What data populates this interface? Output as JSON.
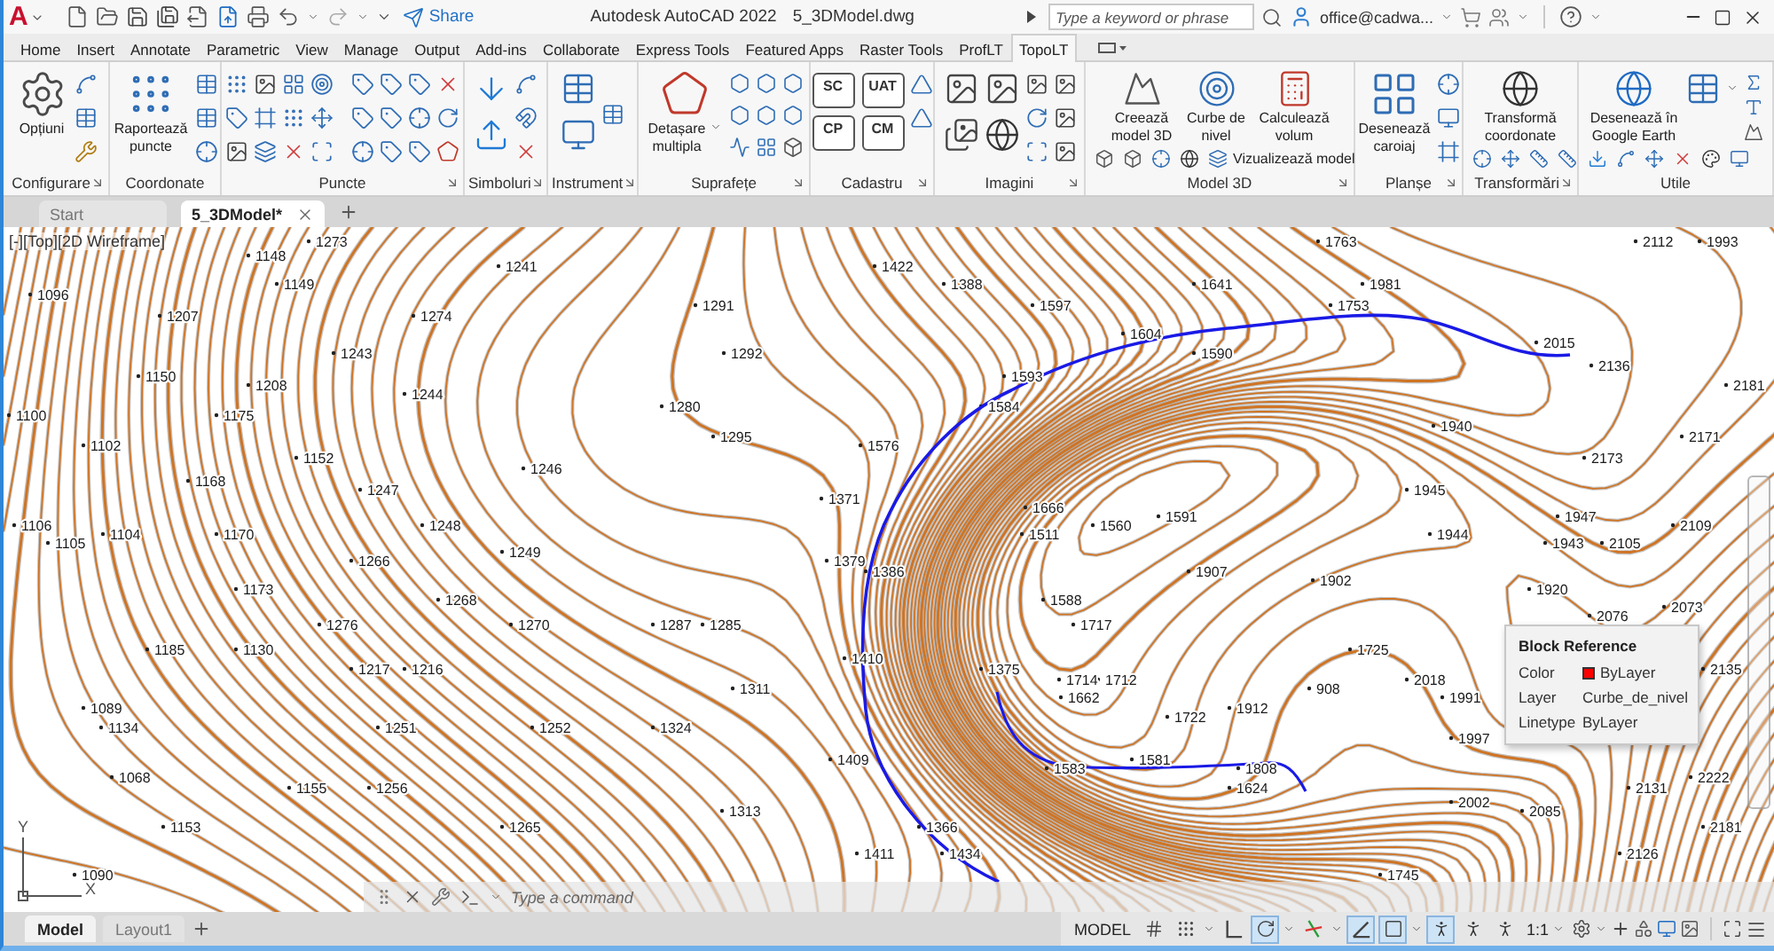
{
  "title_bar": {
    "logo": "A",
    "share": "Share",
    "app_title": "Autodesk AutoCAD 2022",
    "file_name": "5_3DModel.dwg",
    "search": {
      "placeholder": "Type a keyword or phrase"
    },
    "account": "office@cadwa..."
  },
  "ribbon_tabs": [
    {
      "label": "Home",
      "selected": false
    },
    {
      "label": "Insert",
      "selected": false
    },
    {
      "label": "Annotate",
      "selected": false
    },
    {
      "label": "Parametric",
      "selected": false
    },
    {
      "label": "View",
      "selected": false
    },
    {
      "label": "Manage",
      "selected": false
    },
    {
      "label": "Output",
      "selected": false
    },
    {
      "label": "Add-ins",
      "selected": false
    },
    {
      "label": "Collaborate",
      "selected": false
    },
    {
      "label": "Express Tools",
      "selected": false
    },
    {
      "label": "Featured Apps",
      "selected": false
    },
    {
      "label": "Raster Tools",
      "selected": false
    },
    {
      "label": "ProfLT",
      "selected": false
    },
    {
      "label": "TopoLT",
      "selected": true
    }
  ],
  "ribbon_panels": [
    {
      "title": "Configurare",
      "launcher": true,
      "buttons": [
        "Opțiuni"
      ]
    },
    {
      "title": "Coordonate",
      "launcher": false,
      "buttons": [
        "Raportează puncte"
      ]
    },
    {
      "title": "Puncte",
      "launcher": true
    },
    {
      "title": "Simboluri",
      "launcher": true
    },
    {
      "title": "Instrument",
      "launcher": true
    },
    {
      "title": "Suprafețe",
      "launcher": true,
      "buttons": [
        "Detașare multipla"
      ]
    },
    {
      "title": "Cadastru",
      "launcher": true,
      "codes": [
        "SC",
        "UAT",
        "CP",
        "CM"
      ]
    },
    {
      "title": "Imagini",
      "launcher": true
    },
    {
      "title": "Model 3D",
      "launcher": true,
      "buttons": [
        "Creează model 3D",
        "Curbe de nivel",
        "Calculează volum"
      ],
      "small_buttons": [
        "Vizualizează model"
      ]
    },
    {
      "title": "Planșe",
      "launcher": true,
      "buttons": [
        "Desenează caroiaj"
      ]
    },
    {
      "title": "Transformări",
      "launcher": true,
      "buttons": [
        "Transformă coordonate"
      ]
    },
    {
      "title": "Utile",
      "launcher": false,
      "buttons": [
        "Desenează în Google Earth"
      ]
    }
  ],
  "file_tabs": [
    {
      "label": "Start",
      "selected": false
    },
    {
      "label": "5_3DModel*",
      "selected": true
    }
  ],
  "canvas": {
    "viewport_label": "[-][Top][2D Wireframe]",
    "ucs": {
      "x_label": "X",
      "y_label": "Y"
    },
    "point_labels": [
      "1273",
      "1763",
      "2112",
      "1993",
      "1148",
      "1241",
      "1422",
      "1149",
      "1388",
      "1641",
      "1981",
      "1096",
      "1291",
      "1597",
      "1753",
      "1207",
      "1274",
      "1604",
      "2015",
      "1243",
      "1292",
      "1590",
      "2136",
      "1150",
      "1593",
      "1208",
      "2181",
      "1244",
      "1280",
      "1584",
      "1100",
      "1175",
      "1940",
      "1295",
      "2171",
      "1102",
      "1576",
      "1152",
      "2173",
      "1246",
      "1168",
      "1247",
      "1945",
      "1371",
      "1666",
      "1591",
      "1947",
      "1106",
      "1248",
      "1560",
      "2109",
      "1104",
      "1170",
      "1511",
      "1944",
      "1105",
      "1943",
      "2105",
      "1249",
      "1266",
      "1379",
      "1386",
      "1907",
      "1902",
      "1173",
      "1920",
      "1268",
      "1588",
      "2073",
      "2076",
      "1276",
      "1270",
      "1287",
      "1285",
      "1717",
      "1185",
      "1130",
      "1725",
      "1410",
      "1217",
      "1216",
      "1375",
      "2135",
      "1714",
      "1712",
      "2018",
      "1311",
      "908",
      "1662",
      "1991",
      "1089",
      "1912",
      "1722",
      "1134",
      "1251",
      "1252",
      "1324",
      "1997",
      "1409",
      "1581",
      "1583",
      "1808",
      "1068",
      "2222",
      "1155",
      "1256",
      "1624",
      "2131",
      "2002",
      "1313",
      "2085",
      "1153",
      "1265",
      "1366",
      "2181",
      "1411",
      "1434",
      "2126",
      "1090",
      "1745"
    ],
    "tooltip": {
      "title": "Block Reference",
      "properties": [
        {
          "name": "Color",
          "value": "ByLayer",
          "color": "#ff0000"
        },
        {
          "name": "Layer",
          "value": "Curbe_de_nivel"
        },
        {
          "name": "Linetype",
          "value": "ByLayer"
        }
      ]
    }
  },
  "command_line": {
    "placeholder": "Type a command"
  },
  "layout_tabs": [
    {
      "label": "Model",
      "selected": true
    },
    {
      "label": "Layout1",
      "selected": false
    }
  ],
  "status_bar": {
    "space": "MODEL",
    "toggles": [
      {
        "on": false
      },
      {
        "on": false
      },
      {
        "on": false
      },
      {
        "on": true
      },
      {
        "on": false
      },
      {
        "on": true
      },
      {
        "on": true
      },
      {
        "on": true
      },
      {
        "on": false
      },
      {
        "on": false
      }
    ],
    "scale": "1:1"
  }
}
